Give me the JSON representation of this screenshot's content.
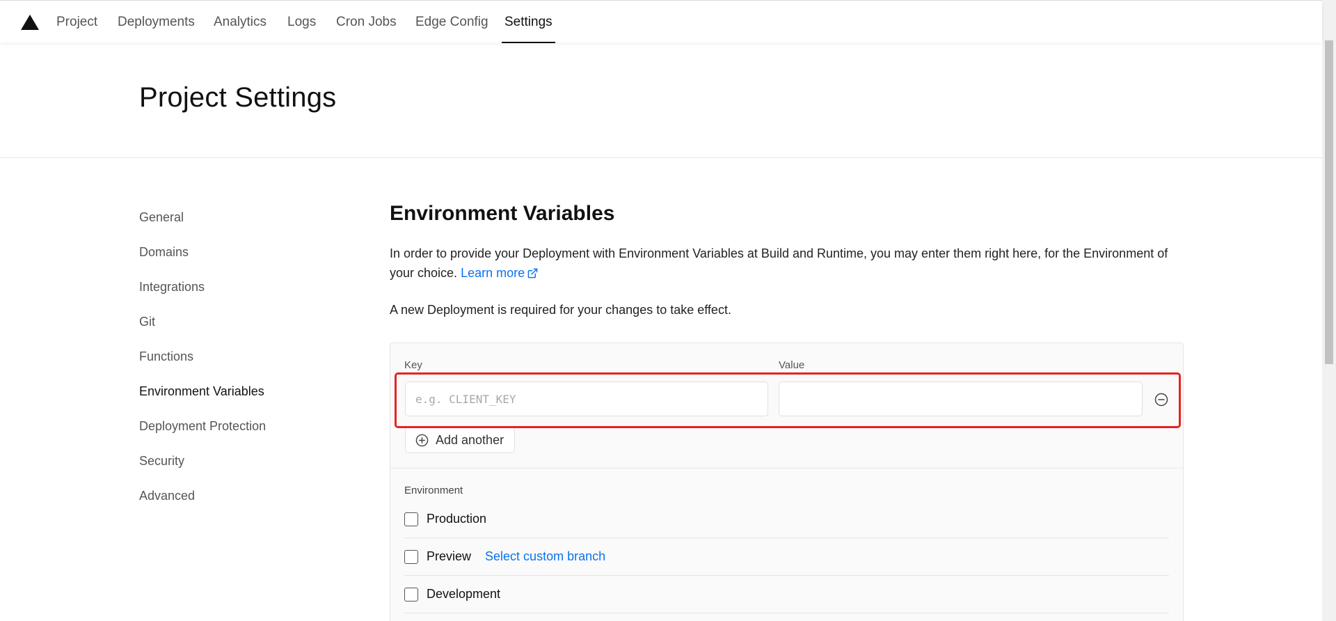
{
  "nav": {
    "logo_icon": "triangle-logo",
    "items": [
      {
        "label": "Project"
      },
      {
        "label": "Deployments"
      },
      {
        "label": "Analytics"
      },
      {
        "label": "Logs"
      },
      {
        "label": "Cron Jobs"
      },
      {
        "label": "Edge Config"
      },
      {
        "label": "Settings",
        "active": true
      }
    ]
  },
  "header": {
    "title": "Project Settings"
  },
  "sidebar": {
    "items": [
      {
        "label": "General"
      },
      {
        "label": "Domains"
      },
      {
        "label": "Integrations"
      },
      {
        "label": "Git"
      },
      {
        "label": "Functions"
      },
      {
        "label": "Environment Variables",
        "active": true
      },
      {
        "label": "Deployment Protection"
      },
      {
        "label": "Security"
      },
      {
        "label": "Advanced"
      }
    ]
  },
  "main": {
    "title": "Environment Variables",
    "description": "In order to provide your Deployment with Environment Variables at Build and Runtime, you may enter them right here, for the Environment of your choice.",
    "learn_more": "Learn more",
    "notice": "A new Deployment is required for your changes to take effect.",
    "form": {
      "key_label": "Key",
      "value_label": "Value",
      "key_placeholder": "e.g. CLIENT_KEY",
      "key_value": "",
      "value_value": "",
      "remove_icon": "minus-circle-icon",
      "add_icon": "plus-circle-icon",
      "add_label": "Add another",
      "environment_label": "Environment",
      "environments": [
        {
          "label": "Production",
          "checked": false
        },
        {
          "label": "Preview",
          "checked": false
        },
        {
          "label": "Development",
          "checked": false
        }
      ],
      "custom_branch_label": "Select custom branch"
    }
  },
  "colors": {
    "accent_link": "#0a72ef",
    "highlight": "#e8231f"
  }
}
